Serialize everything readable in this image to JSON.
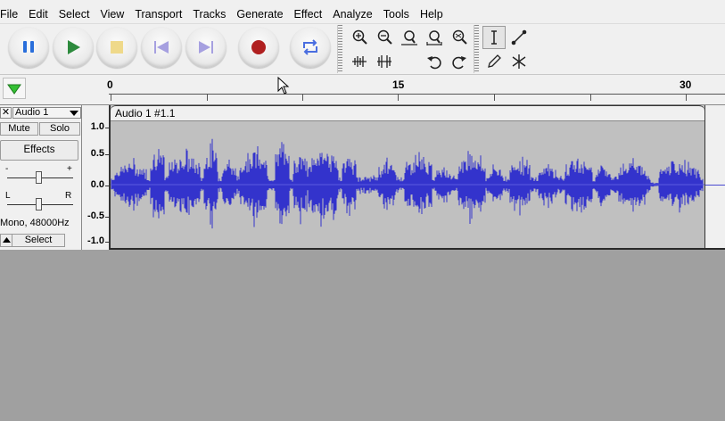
{
  "menu": [
    "File",
    "Edit",
    "Select",
    "View",
    "Transport",
    "Tracks",
    "Generate",
    "Effect",
    "Analyze",
    "Tools",
    "Help"
  ],
  "transport_icons": [
    "pause-icon",
    "play-icon",
    "stop-icon",
    "skip-to-start-icon",
    "skip-to-end-icon",
    "record-icon",
    "loop-icon"
  ],
  "tool_icons": [
    "zoom-in-icon",
    "zoom-out-icon",
    "fit-selection-icon",
    "fit-project-icon",
    "zoom-toggle-icon",
    "selection-tool-icon",
    "envelope-tool-icon",
    "trim-outside-icon",
    "silence-icon",
    "undo-icon",
    "redo-icon",
    "draw-tool-icon",
    "multi-tool-icon"
  ],
  "ruler": {
    "labels": [
      "0",
      "15",
      "30"
    ]
  },
  "track": {
    "name": "Audio 1",
    "close": "✕",
    "mute": "Mute",
    "solo": "Solo",
    "effects": "Effects",
    "gain_minus": "-",
    "gain_plus": "+",
    "pan_left": "L",
    "pan_right": "R",
    "rate": "Mono, 48000Hz",
    "select": "Select",
    "clip_name": "Audio 1 #1.1",
    "scale": [
      "1.0",
      "0.5",
      "0.0",
      "-0.5",
      "-1.0"
    ]
  },
  "colors": {
    "wave": "#3333cc",
    "wave_background": "#c0c0c0",
    "record": "#b02020",
    "play": "#2e8b3e",
    "pause": "#2a6fdb",
    "accent_blue": "#4a6ee0"
  }
}
